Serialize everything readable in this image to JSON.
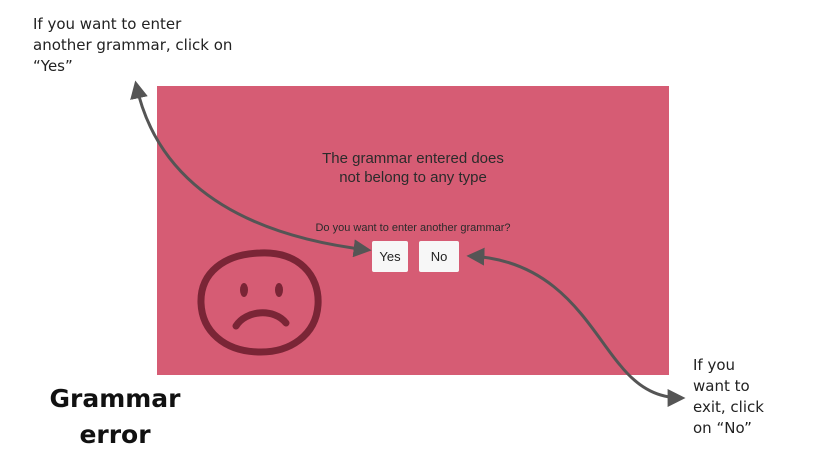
{
  "annotations": {
    "yes_hint": "If you want to enter\nanother grammar, click on\n“Yes”",
    "no_hint": "If you\nwant to\nexit, click\non “No”"
  },
  "caption": "Grammar\nerror",
  "dialog": {
    "message": "The grammar entered does not belong to any type",
    "question": "Do you want to enter another grammar?",
    "yes_label": "Yes",
    "no_label": "No",
    "background_color": "#d65c74",
    "face_icon": "sad-face-icon"
  }
}
